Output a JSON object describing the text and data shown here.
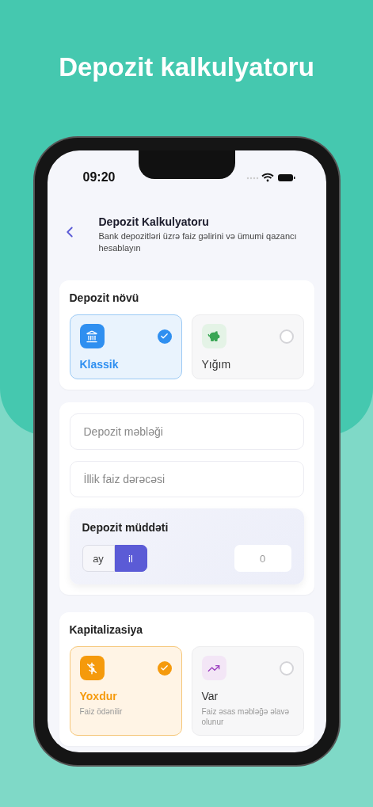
{
  "headline": "Depozit kalkulyatoru",
  "status_bar": {
    "time": "09:20"
  },
  "header": {
    "title": "Depozit Kalkulyatoru",
    "subtitle": "Bank depozitləri üzrə faiz gəlirini və ümumi qazancı hesablayın"
  },
  "deposit_type": {
    "label": "Depozit növü",
    "options": [
      {
        "kind": "bank",
        "title": "Klassik",
        "selected": true
      },
      {
        "kind": "piggy",
        "title": "Yığım",
        "selected": false
      }
    ]
  },
  "fields": [
    {
      "placeholder": "Depozit məbləği"
    },
    {
      "placeholder": "İllik faiz dərəcəsi"
    }
  ],
  "term": {
    "label": "Depozit müddəti",
    "units": [
      {
        "label": "ay",
        "selected": false
      },
      {
        "label": "il",
        "selected": true
      }
    ],
    "value": "0"
  },
  "capitalization": {
    "label": "Kapitalizasiya",
    "options": [
      {
        "kind": "no-interest",
        "title": "Yoxdur",
        "description": "Faiz ödənilir",
        "selected": true
      },
      {
        "kind": "growth",
        "title": "Var",
        "description": "Faiz əsas məbləğə əlavə olunur",
        "selected": false
      }
    ]
  }
}
